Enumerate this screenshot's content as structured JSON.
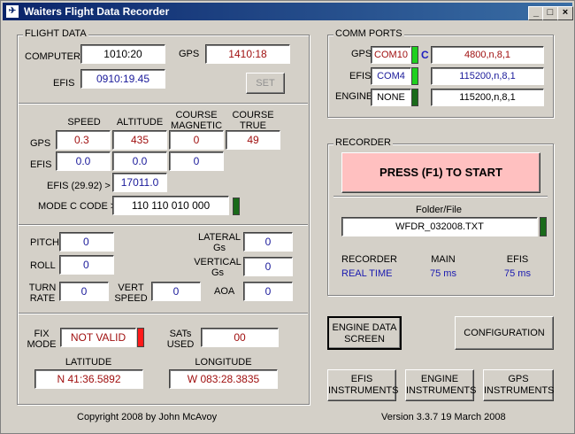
{
  "window": {
    "title": "Waiters Flight Data Recorder",
    "icon_name": "app-icon"
  },
  "flight_data": {
    "group_title": "FLIGHT DATA",
    "computer_label": "COMPUTER",
    "computer_value": "1010:20",
    "gps_label": "GPS",
    "gps_time": "1410:18",
    "efis_label": "EFIS",
    "efis_time": "0910:19.45",
    "set_button": "SET",
    "col_speed": "SPEED",
    "col_altitude": "ALTITUDE",
    "col_course_mag": "COURSE MAGNETIC",
    "col_course_true": "COURSE TRUE",
    "row_gps": "GPS",
    "row_efis": "EFIS",
    "gps_speed": "0.3",
    "gps_altitude": "435",
    "gps_course_mag": "0",
    "gps_course_true": "49",
    "efis_speed": "0.0",
    "efis_altitude": "0.0",
    "efis_course_mag": "0",
    "efis_baro_label": "EFIS (29.92) >",
    "efis_baro_value": "17011.0",
    "modec_label": "MODE C CODE >",
    "modec_value": "110  110  010  000",
    "pitch_label": "PITCH",
    "pitch_value": "0",
    "roll_label": "ROLL",
    "roll_value": "0",
    "turn_label": "TURN RATE",
    "turn_value": "0",
    "vert_label": "VERT SPEED",
    "vert_value": "0",
    "lat_gs_label": "LATERAL Gs",
    "lat_gs_value": "0",
    "vert_gs_label": "VERTICAL Gs",
    "vert_gs_value": "0",
    "aoa_label": "AOA",
    "aoa_value": "0",
    "fix_label": "FIX MODE",
    "fix_value": "NOT VALID",
    "sats_label": "SATs USED",
    "sats_value": "00",
    "latitude_label": "LATITUDE",
    "latitude_value": "N 41:36.5892",
    "longitude_label": "LONGITUDE",
    "longitude_value": "W 083:28.3835"
  },
  "comm_ports": {
    "group_title": "COMM PORTS",
    "gps_label": "GPS",
    "gps_port": "COM10",
    "gps_marker": "C",
    "gps_settings": "4800,n,8,1",
    "efis_label": "EFIS",
    "efis_port": "COM4",
    "efis_settings": "115200,n,8,1",
    "engine_label": "ENGINE",
    "engine_port": "NONE",
    "engine_settings": "115200,n,8,1"
  },
  "recorder": {
    "group_title": "RECORDER",
    "start_button": "PRESS (F1) TO START",
    "folder_label": "Folder/File",
    "file_value": "WFDR_032008.TXT",
    "recorder_label": "RECORDER",
    "recorder_value": "REAL TIME",
    "main_label": "MAIN",
    "main_value": "75 ms",
    "efis_label": "EFIS",
    "efis_value": "75 ms"
  },
  "buttons": {
    "engine_data": "ENGINE DATA SCREEN",
    "configuration": "CONFIGURATION",
    "efis_instruments": "EFIS INSTRUMENTS",
    "engine_instruments": "ENGINE INSTRUMENTS",
    "gps_instruments": "GPS INSTRUMENTS"
  },
  "footer": {
    "copyright": "Copyright 2008   by  John McAvoy",
    "version": "Version 3.3.7 19 March 2008"
  },
  "colors": {
    "led_green": "#1fb01f",
    "led_dark_green": "#1a6a1a",
    "led_red": "#ff1a1a",
    "start_bg": "#ffc0c0"
  }
}
